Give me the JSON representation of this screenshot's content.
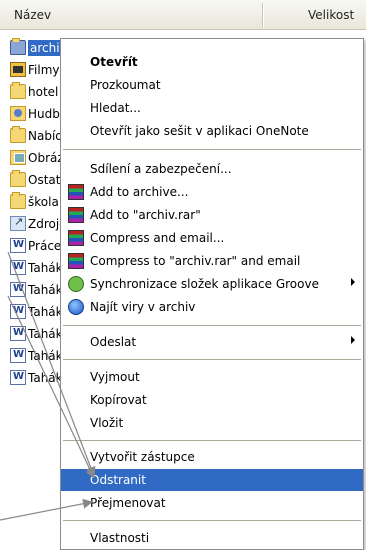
{
  "header": {
    "name_col": "Název",
    "size_col": "Velikost"
  },
  "files": [
    {
      "name": "archiv",
      "icon": "folder-icon",
      "selected": true
    },
    {
      "name": "Filmy",
      "icon": "video-folder-icon"
    },
    {
      "name": "hotel",
      "icon": "folder-icon"
    },
    {
      "name": "Hudba",
      "icon": "music-folder-icon"
    },
    {
      "name": "Nabídky",
      "icon": "folder-icon"
    },
    {
      "name": "Obrázky",
      "icon": "pictures-folder-icon"
    },
    {
      "name": "Ostatní",
      "icon": "folder-icon"
    },
    {
      "name": "škola",
      "icon": "folder-icon"
    },
    {
      "name": "Zdroje",
      "icon": "shortcut-icon"
    },
    {
      "name": "Práce",
      "icon": "word-doc-icon"
    },
    {
      "name": "Tahák",
      "icon": "word-doc-icon"
    },
    {
      "name": "Tahák",
      "icon": "word-doc-icon"
    },
    {
      "name": "Tahák",
      "icon": "word-doc-icon"
    },
    {
      "name": "Tahák",
      "icon": "word-doc-icon"
    },
    {
      "name": "Tahák",
      "icon": "word-doc-icon"
    },
    {
      "name": "Tahák",
      "icon": "word-doc-icon"
    }
  ],
  "menu": {
    "items": [
      {
        "label": "Otevřít",
        "bold": true
      },
      {
        "label": "Prozkoumat"
      },
      {
        "label": "Hledat..."
      },
      {
        "label": "Otevřít jako sešit v aplikaci OneNote"
      },
      {
        "label": "Sdílení a zabezpečení..."
      },
      {
        "label": "Add to archive...",
        "icon": "winrar-icon"
      },
      {
        "label": "Add to \"archiv.rar\"",
        "icon": "winrar-icon"
      },
      {
        "label": "Compress and email...",
        "icon": "winrar-icon"
      },
      {
        "label": "Compress to \"archiv.rar\" and email",
        "icon": "winrar-icon"
      },
      {
        "label": "Synchronizace složek aplikace Groove",
        "icon": "groove-icon",
        "submenu": true
      },
      {
        "label": "Najít viry v archiv",
        "icon": "antivirus-icon"
      },
      {
        "label": "Odeslat",
        "submenu": true
      },
      {
        "label": "Vyjmout"
      },
      {
        "label": "Kopírovat"
      },
      {
        "label": "Vložit"
      },
      {
        "label": "Vytvořit zástupce"
      },
      {
        "label": "Odstranit",
        "highlighted": true
      },
      {
        "label": "Přejmenovat"
      },
      {
        "label": "Vlastnosti"
      }
    ]
  },
  "colors": {
    "selection": "#316ac5",
    "menu_border": "#8d8d8d",
    "separator": "#aca899"
  }
}
